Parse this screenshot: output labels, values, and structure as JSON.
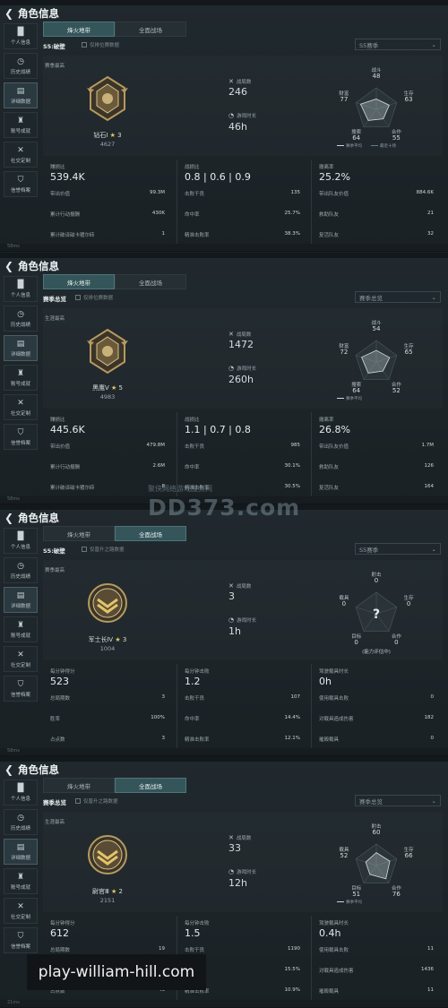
{
  "panels": [
    {
      "back_icon": "back-arrow-icon",
      "title": "角色信息",
      "sidebar": [
        {
          "icon": "chart-icon",
          "label": "个人信息"
        },
        {
          "icon": "history-icon",
          "label": "历史战绩"
        },
        {
          "icon": "folder-icon",
          "label": "详细数据"
        },
        {
          "icon": "trophy-icon",
          "label": "账号成就"
        },
        {
          "icon": "tools-icon",
          "label": "社交定制"
        },
        {
          "icon": "shield-icon",
          "label": "信誉档案"
        }
      ],
      "tabs": [
        "烽火地带",
        "全面战场"
      ],
      "active_tab": 0,
      "season": "S5:破壁",
      "checkbox_label": "仅排位赛数据",
      "dropdown": "S5赛季",
      "max_label": "赛季最高",
      "rank_name": "钻石Ⅰ",
      "rank_stars": "3",
      "rank_points": "4627",
      "stat_a_label": "战局数",
      "stat_a_value": "246",
      "stat_b_label": "游戏时长",
      "stat_b_value": "46h",
      "radar": [
        {
          "label": "战斗",
          "value": "48"
        },
        {
          "label": "生存",
          "value": "63"
        },
        {
          "label": "合作",
          "value": "55"
        },
        {
          "label": "搜索",
          "value": "64"
        },
        {
          "label": "财富",
          "value": "77"
        }
      ],
      "legend_a": "赛季平均",
      "legend_b": "最近十场",
      "b1": {
        "head_label": "赚损比",
        "head_value": "539.4K",
        "rows": [
          [
            "带出价值",
            "99.3M"
          ],
          [
            "累计行动报酬",
            "430K"
          ],
          [
            "累计破译磁卡猪尔砖",
            "1"
          ]
        ]
      },
      "b2": {
        "head_label": "战损比",
        "head_value": "0.8 | 0.6 | 0.9",
        "rows": [
          [
            "击败干员",
            "135"
          ],
          [
            "命中率",
            "25.7%"
          ],
          [
            "精准击败率",
            "38.3%"
          ]
        ]
      },
      "b3": {
        "head_label": "撤离率",
        "head_value": "25.2%",
        "rows": [
          [
            "带出队友价值",
            "884.6K"
          ],
          [
            "救助队友",
            "21"
          ],
          [
            "复活队友",
            "32"
          ]
        ]
      },
      "footer": "58ms"
    },
    {
      "back_icon": "back-arrow-icon",
      "title": "角色信息",
      "sidebar": [
        {
          "icon": "chart-icon",
          "label": "个人信息"
        },
        {
          "icon": "history-icon",
          "label": "历史战绩"
        },
        {
          "icon": "folder-icon",
          "label": "详细数据"
        },
        {
          "icon": "trophy-icon",
          "label": "账号成就"
        },
        {
          "icon": "tools-icon",
          "label": "社交定制"
        },
        {
          "icon": "shield-icon",
          "label": "信誉档案"
        }
      ],
      "tabs": [
        "烽火地带",
        "全面战场"
      ],
      "active_tab": 0,
      "season": "赛季总览",
      "checkbox_label": "仅排位赛数据",
      "dropdown": "赛季总览",
      "max_label": "生涯最高",
      "rank_name": "黑鹰Ⅴ",
      "rank_stars": "5",
      "rank_points": "4983",
      "stat_a_label": "战局数",
      "stat_a_value": "1472",
      "stat_b_label": "游戏时长",
      "stat_b_value": "260h",
      "radar": [
        {
          "label": "战斗",
          "value": "54"
        },
        {
          "label": "生存",
          "value": "65"
        },
        {
          "label": "合作",
          "value": "52"
        },
        {
          "label": "搜索",
          "value": "64"
        },
        {
          "label": "财富",
          "value": "72"
        }
      ],
      "legend_a": "赛季平均",
      "legend_b": "",
      "b1": {
        "head_label": "赚损比",
        "head_value": "445.6K",
        "rows": [
          [
            "带出价值",
            "479.8M"
          ],
          [
            "累计行动报酬",
            "2.6M"
          ],
          [
            "累计破译磁卡猪尔砖",
            "8"
          ]
        ]
      },
      "b2": {
        "head_label": "战损比",
        "head_value": "1.1 | 0.7 | 0.8",
        "rows": [
          [
            "击败干员",
            "985"
          ],
          [
            "命中率",
            "30.1%"
          ],
          [
            "精准击败率",
            "30.5%"
          ]
        ]
      },
      "b3": {
        "head_label": "撤离率",
        "head_value": "26.8%",
        "rows": [
          [
            "带出队友价值",
            "1.7M"
          ],
          [
            "救助队友",
            "126"
          ],
          [
            "复活队友",
            "164"
          ]
        ]
      },
      "footer": "58ms"
    },
    {
      "back_icon": "back-arrow-icon",
      "title": "角色信息",
      "sidebar": [
        {
          "icon": "chart-icon",
          "label": "个人信息"
        },
        {
          "icon": "history-icon",
          "label": "历史战绩"
        },
        {
          "icon": "folder-icon",
          "label": "详细数据"
        },
        {
          "icon": "trophy-icon",
          "label": "账号成就"
        },
        {
          "icon": "tools-icon",
          "label": "社交定制"
        },
        {
          "icon": "shield-icon",
          "label": "信誉档案"
        }
      ],
      "tabs": [
        "烽火地带",
        "全面战场"
      ],
      "active_tab": 1,
      "season": "S5:破壁",
      "checkbox_label": "仅晋升之路数据",
      "dropdown": "S5赛季",
      "max_label": "赛季最高",
      "rank_name": "军士长Ⅳ",
      "rank_stars": "3",
      "rank_points": "1004",
      "stat_a_label": "战局数",
      "stat_a_value": "3",
      "stat_b_label": "游戏时长",
      "stat_b_value": "1h",
      "radar": [
        {
          "label": "射击",
          "value": "0"
        },
        {
          "label": "生存",
          "value": "0"
        },
        {
          "label": "合作",
          "value": "0"
        },
        {
          "label": "目标",
          "value": "0"
        },
        {
          "label": "载具",
          "value": "0"
        }
      ],
      "radar_note": "(能力评估中)",
      "legend_a": "",
      "legend_b": "",
      "b1": {
        "head_label": "每分钟得分",
        "head_value": "523",
        "rows": [
          [
            "总局期数",
            "3"
          ],
          [
            "胜率",
            "100%"
          ],
          [
            "占点数",
            "3"
          ]
        ]
      },
      "b2": {
        "head_label": "每分钟击败",
        "head_value": "1.2",
        "rows": [
          [
            "击败干员",
            "107"
          ],
          [
            "命中率",
            "14.4%"
          ],
          [
            "精准击败率",
            "12.1%"
          ]
        ]
      },
      "b3": {
        "head_label": "驾驶载具时长",
        "head_value": "0h",
        "rows": [
          [
            "使用载具击败",
            "0"
          ],
          [
            "对载具造成伤害",
            "182"
          ],
          [
            "摧毁载具",
            "0"
          ]
        ]
      },
      "footer": "58ms"
    },
    {
      "back_icon": "back-arrow-icon",
      "title": "角色信息",
      "sidebar": [
        {
          "icon": "chart-icon",
          "label": "个人信息"
        },
        {
          "icon": "history-icon",
          "label": "历史战绩"
        },
        {
          "icon": "folder-icon",
          "label": "详细数据"
        },
        {
          "icon": "trophy-icon",
          "label": "账号成就"
        },
        {
          "icon": "tools-icon",
          "label": "社交定制"
        },
        {
          "icon": "shield-icon",
          "label": "信誉档案"
        }
      ],
      "tabs": [
        "烽火地带",
        "全面战场"
      ],
      "active_tab": 1,
      "season": "赛季总览",
      "checkbox_label": "仅晋升之路数据",
      "dropdown": "赛季总览",
      "max_label": "生涯最高",
      "rank_name": "尉官Ⅲ",
      "rank_stars": "2",
      "rank_points": "2151",
      "stat_a_label": "战局数",
      "stat_a_value": "33",
      "stat_b_label": "游戏时长",
      "stat_b_value": "12h",
      "radar": [
        {
          "label": "射击",
          "value": "60"
        },
        {
          "label": "生存",
          "value": "66"
        },
        {
          "label": "合作",
          "value": "76"
        },
        {
          "label": "目标",
          "value": "51"
        },
        {
          "label": "载具",
          "value": "52"
        }
      ],
      "legend_a": "赛季平均",
      "legend_b": "",
      "b1": {
        "head_label": "每分钟得分",
        "head_value": "612",
        "rows": [
          [
            "总局期数",
            "19"
          ],
          [
            "胜率",
            ""
          ],
          [
            "占点数",
            "46"
          ]
        ]
      },
      "b2": {
        "head_label": "每分钟击败",
        "head_value": "1.5",
        "rows": [
          [
            "击败干员",
            "1190"
          ],
          [
            "命中率",
            "15.5%"
          ],
          [
            "精准击败率",
            "10.9%"
          ]
        ]
      },
      "b3": {
        "head_label": "驾驶载具时长",
        "head_value": "0.4h",
        "rows": [
          [
            "使用载具击败",
            "11"
          ],
          [
            "对载具造成伤害",
            "1436"
          ],
          [
            "摧毁载具",
            "11"
          ]
        ]
      },
      "footer": "21ms"
    }
  ],
  "watermark": {
    "line1": "聚侠网络游戏服务网",
    "line2": "DD373.com"
  },
  "site_watermark": "play-william-hill.com",
  "colors": {
    "accent_tab": "#34555a",
    "background": "#1b2226",
    "gold": "#e2c46a"
  }
}
